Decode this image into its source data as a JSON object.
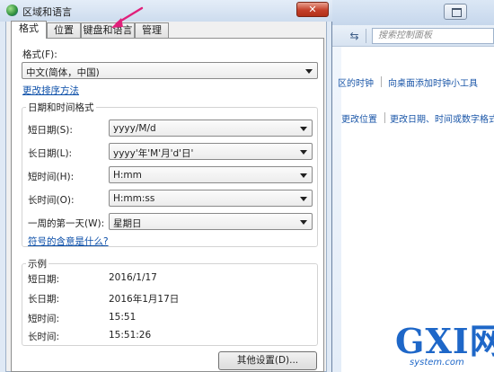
{
  "background_window": {
    "search_placeholder": "搜索控制面板",
    "refresh_icon": "refresh-arrows-icon",
    "links": [
      "区的时钟",
      "向桌面添加时钟小工具",
      "更改位置",
      "更改日期、时间或数字格式"
    ]
  },
  "dialog": {
    "title": "区域和语言",
    "close_label": "✕",
    "tabs": [
      "格式",
      "位置",
      "键盘和语言",
      "管理"
    ],
    "active_tab": "格式",
    "format_label": "格式(F):",
    "format_value": "中文(简体，中国)",
    "sort_link": "更改排序方法",
    "datetime_group": "日期和时间格式",
    "fields": [
      {
        "label": "短日期(S):",
        "value": "yyyy/M/d"
      },
      {
        "label": "长日期(L):",
        "value": "yyyy'年'M'月'd'日'"
      },
      {
        "label": "短时间(H):",
        "value": "H:mm"
      },
      {
        "label": "长时间(O):",
        "value": "H:mm:ss"
      },
      {
        "label": "一周的第一天(W):",
        "value": "星期日"
      }
    ],
    "symbols_link": "符号的含意是什么?",
    "example_group": "示例",
    "examples": [
      {
        "label": "短日期:",
        "value": "2016/1/17"
      },
      {
        "label": "长日期:",
        "value": "2016年1月17日"
      },
      {
        "label": "短时间:",
        "value": "15:51"
      },
      {
        "label": "长时间:",
        "value": "15:51:26"
      }
    ],
    "other_settings_button": "其他设置(D)..."
  },
  "watermark": {
    "letters": "GXI网",
    "sub": "system.com"
  },
  "colors": {
    "accent_arrow": "#e0207a",
    "link": "#0b4ea8",
    "watermark": "#1e67c8"
  }
}
